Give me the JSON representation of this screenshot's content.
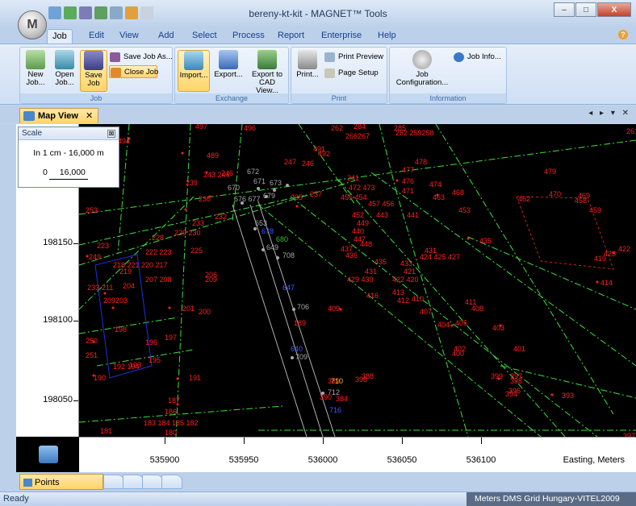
{
  "window": {
    "title": "bereny-kt-kit - MAGNET™ Tools",
    "orb_label": "M",
    "controls": {
      "minimize": "–",
      "maximize": "□",
      "close": "X"
    },
    "help": "?"
  },
  "ribbon_tabs": [
    {
      "label": "Job",
      "active": true
    },
    {
      "label": "Edit"
    },
    {
      "label": "View"
    },
    {
      "label": "Add"
    },
    {
      "label": "Select"
    },
    {
      "label": "Process"
    },
    {
      "label": "Report"
    },
    {
      "label": "Enterprise"
    },
    {
      "label": "Help"
    }
  ],
  "ribbon": {
    "job": {
      "label": "Job",
      "new": "New Job...",
      "open": "Open Job...",
      "save": "Save Job",
      "save_as": "Save Job As...",
      "close": "Close Job"
    },
    "exchange": {
      "label": "Exchange",
      "import": "Import...",
      "export": "Export...",
      "export_cad": "Export to CAD View..."
    },
    "print": {
      "label": "Print",
      "print": "Print...",
      "preview": "Print Preview",
      "setup": "Page Setup"
    },
    "information": {
      "label": "Information",
      "job_config": "Job Configuration...",
      "job_info": "Job Info..."
    }
  },
  "document_tab": {
    "label": "Map View",
    "close": "✕",
    "controls": "◂ ▸ ▾ ✕"
  },
  "scale": {
    "title": "Scale",
    "close": "⊠",
    "ratio": "In 1 cm - 16,000 m",
    "zero": "0",
    "length": "16,000"
  },
  "axes": {
    "y_ticks": [
      "198150",
      "198100",
      "198050"
    ],
    "x_ticks": [
      "535900",
      "535950",
      "536000",
      "536050",
      "536100"
    ],
    "x_label": "Easting, Meters"
  },
  "map_points": {
    "red": [
      "497",
      "494",
      "496",
      "489",
      "491",
      "492",
      "493",
      "282",
      "284",
      "285",
      "266",
      "267",
      "262",
      "259",
      "258",
      "261",
      "245",
      "247",
      "246",
      "243",
      "244",
      "239",
      "236",
      "241",
      "237",
      "235",
      "232",
      "233",
      "234",
      "238",
      "248",
      "253",
      "229",
      "230",
      "228",
      "225",
      "222",
      "223",
      "219",
      "218",
      "221",
      "220",
      "213",
      "215",
      "216",
      "217",
      "227",
      "226",
      "214",
      "207",
      "208",
      "209",
      "204",
      "203",
      "211",
      "212",
      "206",
      "205",
      "202",
      "201",
      "200",
      "199",
      "198",
      "197",
      "196",
      "195",
      "194",
      "193",
      "192",
      "191",
      "190",
      "189",
      "188",
      "187",
      "186",
      "185",
      "184",
      "183",
      "182",
      "181",
      "180",
      "179",
      "178",
      "177",
      "176",
      "250",
      "251",
      "252",
      "253",
      "477",
      "478",
      "476",
      "474",
      "471",
      "472",
      "473",
      "470",
      "468",
      "463",
      "462",
      "469",
      "458",
      "459",
      "460",
      "453",
      "457",
      "456",
      "455",
      "454",
      "452",
      "451",
      "450",
      "449",
      "448",
      "447",
      "446",
      "445",
      "443",
      "441",
      "440",
      "439",
      "438",
      "437",
      "436",
      "435",
      "434",
      "433",
      "432",
      "431",
      "430",
      "429",
      "428",
      "427",
      "426",
      "425",
      "424",
      "423",
      "422",
      "421",
      "420",
      "419",
      "418",
      "417",
      "416",
      "415",
      "414",
      "413",
      "412",
      "411",
      "410",
      "409",
      "408",
      "407",
      "406",
      "405",
      "404",
      "403",
      "402",
      "401",
      "400",
      "399",
      "398",
      "397",
      "396",
      "395",
      "394",
      "393",
      "392",
      "391",
      "390",
      "389",
      "388",
      "387",
      "386",
      "385",
      "384",
      "710"
    ],
    "gray": [
      "670",
      "671",
      "672",
      "673",
      "674",
      "675",
      "676",
      "677",
      "678",
      "679",
      "680",
      "653",
      "650",
      "649",
      "648",
      "647",
      "646",
      "645",
      "708",
      "705",
      "706",
      "707",
      "709",
      "711",
      "712",
      "713",
      "714",
      "715",
      "716"
    ],
    "blue": [
      "678",
      "647",
      "640",
      "715"
    ],
    "green": [
      "680"
    ]
  },
  "bottom_tabs": {
    "points": "Points"
  },
  "status": {
    "left": "Ready",
    "right": "Meters  DMS  Grid  Hungary-VITEL2009"
  }
}
